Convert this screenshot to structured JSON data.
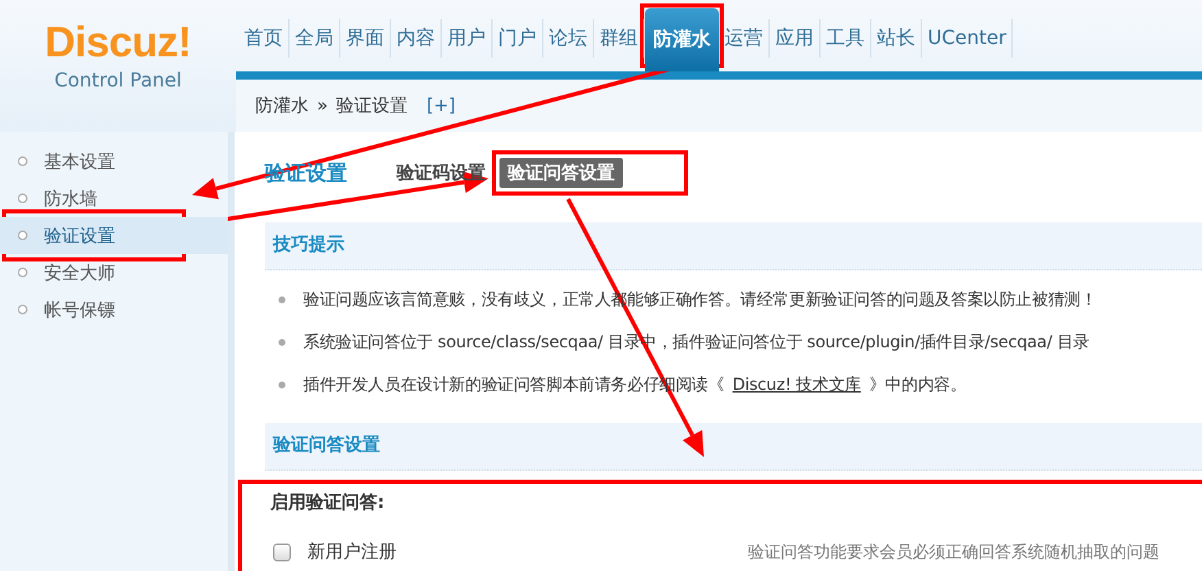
{
  "logo": {
    "name": "Discuz!",
    "subtitle": "Control Panel"
  },
  "nav": [
    {
      "label": "首页",
      "selected": false
    },
    {
      "label": "全局",
      "selected": false
    },
    {
      "label": "界面",
      "selected": false
    },
    {
      "label": "内容",
      "selected": false
    },
    {
      "label": "用户",
      "selected": false
    },
    {
      "label": "门户",
      "selected": false
    },
    {
      "label": "论坛",
      "selected": false
    },
    {
      "label": "群组",
      "selected": false
    },
    {
      "label": "防灌水",
      "selected": true
    },
    {
      "label": "运营",
      "selected": false
    },
    {
      "label": "应用",
      "selected": false
    },
    {
      "label": "工具",
      "selected": false
    },
    {
      "label": "站长",
      "selected": false
    },
    {
      "label": "UCenter",
      "selected": false
    }
  ],
  "breadcrumb": {
    "items": [
      "防灌水",
      "验证设置"
    ],
    "separator": "»",
    "add": "[+]"
  },
  "sidebar": {
    "items": [
      {
        "label": "基本设置",
        "selected": false
      },
      {
        "label": "防水墙",
        "selected": false
      },
      {
        "label": "验证设置",
        "selected": true
      },
      {
        "label": "安全大师",
        "selected": false
      },
      {
        "label": "帐号保镖",
        "selected": false
      }
    ]
  },
  "page": {
    "title": "验证设置",
    "tabs": [
      {
        "label": "验证码设置",
        "selected": false
      },
      {
        "label": "验证问答设置",
        "selected": true
      }
    ]
  },
  "tips": {
    "title": "技巧提示",
    "items": [
      {
        "text": "验证问题应该言简意赅，没有歧义，正常人都能够正确作答。请经常更新验证问答的问题及答案以防止被猜测！"
      },
      {
        "text": "系统验证问答位于 source/class/secqaa/ 目录中，插件验证问答位于 source/plugin/插件目录/secqaa/ 目录"
      },
      {
        "text": "插件开发人员在设计新的验证问答脚本前请务必仔细阅读《",
        "link": "Discuz! 技术文库",
        "after": "》中的内容。"
      }
    ]
  },
  "settings": {
    "title": "验证问答设置",
    "field_label": "启用验证问答:",
    "options": [
      {
        "label": "新用户注册",
        "checked": false
      }
    ],
    "hint": "验证问答功能要求会员必须正确回答系统随机抽取的问题"
  },
  "annotations": [
    {
      "kind": "frame"
    },
    {
      "kind": "frame"
    },
    {
      "kind": "frame"
    },
    {
      "kind": "frame"
    },
    {
      "kind": "arrow"
    },
    {
      "kind": "arrow"
    },
    {
      "kind": "arrow"
    }
  ]
}
